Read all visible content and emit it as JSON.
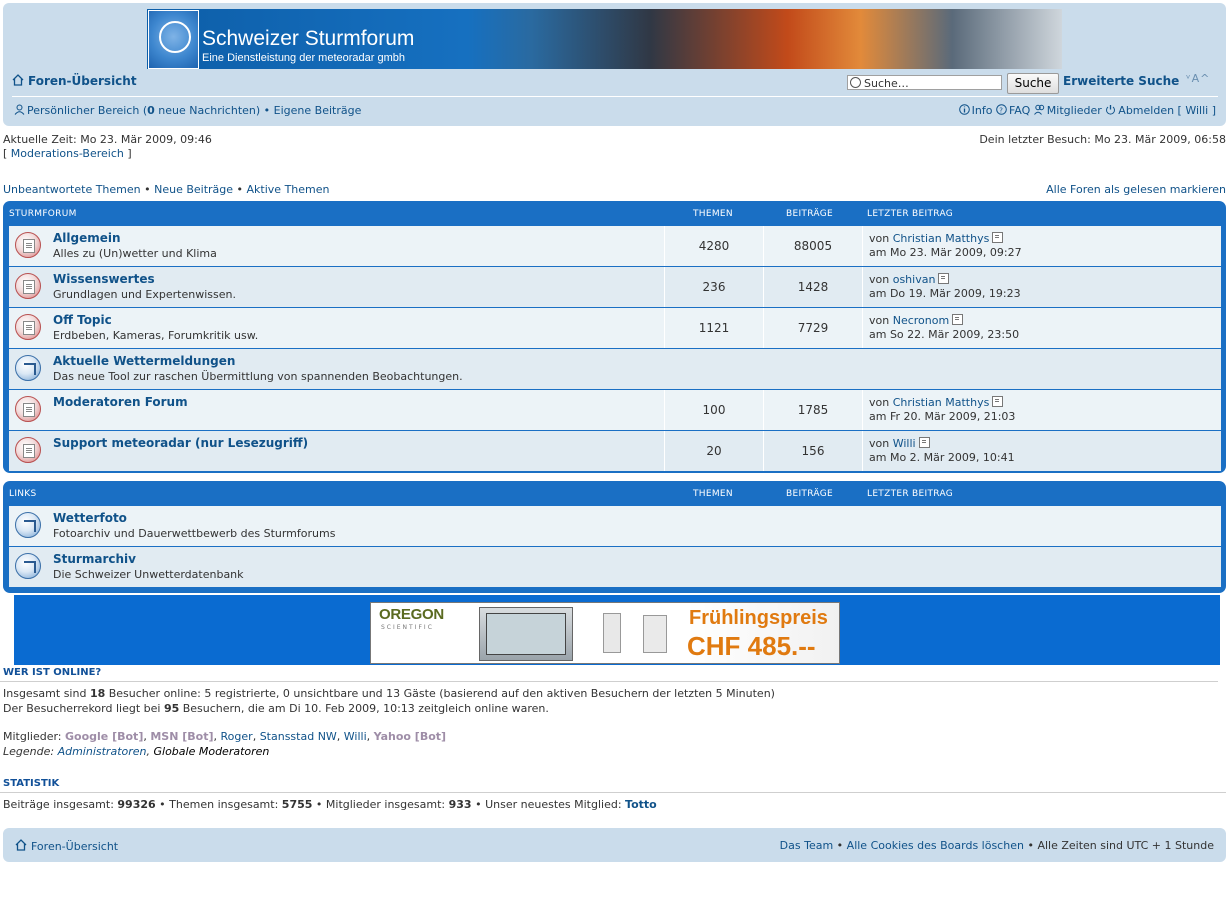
{
  "header": {
    "banner_title": "Schweizer Sturmforum",
    "banner_subtitle": "Eine Dienstleistung der meteoradar gmbh",
    "nav_home": "Foren-Übersicht",
    "search_value": "Suche…",
    "search_button": "Suche",
    "advanced_search": "Erweiterte Suche",
    "font_size_control": "ᵛA^",
    "user_area_a": "Persönlicher Bereich (",
    "user_area_count": "0",
    "user_area_b": " neue Nachrichten)",
    "sep": " • ",
    "own_posts": "Eigene Beiträge",
    "info": "Info",
    "faq": "FAQ",
    "members": "Mitglieder",
    "logout": "Abmelden [ Willi ]"
  },
  "status": {
    "current_time": "Aktuelle Zeit: Mo 23. Mär 2009, 09:46",
    "last_visit": "Dein letzter Besuch: Mo 23. Mär 2009, 06:58",
    "mod_open": "[ ",
    "mod_link": "Moderations-Bereich",
    "mod_close": " ]"
  },
  "quicklinks": {
    "unanswered": "Unbeantwortete Themen",
    "new_posts": "Neue Beiträge",
    "active": "Aktive Themen",
    "sep": " • ",
    "mark_read": "Alle Foren als gelesen markieren"
  },
  "columns": {
    "topics": "THEMEN",
    "posts": "BEITRÄGE",
    "last_post": "LETZTER BEITRAG"
  },
  "sturmforum": {
    "title": "STURMFORUM",
    "rows": [
      {
        "name": "Allgemein",
        "desc": "Alles zu (Un)wetter und Klima",
        "topics": "4280",
        "posts": "88005",
        "by": "von ",
        "user": "Christian Matthys",
        "date": "am Mo 23. Mär 2009, 09:27"
      },
      {
        "name": "Wissenswertes",
        "desc": "Grundlagen und Expertenwissen.",
        "topics": "236",
        "posts": "1428",
        "by": "von ",
        "user": "oshivan",
        "date": "am Do 19. Mär 2009, 19:23"
      },
      {
        "name": "Off Topic",
        "desc": "Erdbeben, Kameras, Forumkritik usw.",
        "topics": "1121",
        "posts": "7729",
        "by": "von ",
        "user": "Necronom",
        "date": "am So 22. Mär 2009, 23:50"
      },
      {
        "name": "Aktuelle Wettermeldungen",
        "desc": "Das neue Tool zur raschen Übermittlung von spannenden Beobachtungen."
      },
      {
        "name": "Moderatoren Forum",
        "desc": "",
        "topics": "100",
        "posts": "1785",
        "by": "von ",
        "user": "Christian Matthys",
        "date": "am Fr 20. Mär 2009, 21:03"
      },
      {
        "name": "Support meteoradar (nur Lesezugriff)",
        "desc": "",
        "topics": "20",
        "posts": "156",
        "by": "von ",
        "user": "Willi",
        "date": "am Mo 2. Mär 2009, 10:41"
      }
    ]
  },
  "links": {
    "title": "LINKS",
    "rows": [
      {
        "name": "Wetterfoto",
        "desc": "Fotoarchiv und Dauerwettbewerb des Sturmforums"
      },
      {
        "name": "Sturmarchiv",
        "desc": "Die Schweizer Unwetterdatenbank"
      }
    ]
  },
  "ad": {
    "brand": "OREGON",
    "brand_sub": "SCIENTIFIC",
    "headline": "Frühlingspreis",
    "price": "CHF 485.--"
  },
  "online": {
    "heading": "WER IST ONLINE?",
    "l1a": "Insgesamt sind ",
    "l1n": "18",
    "l1b": " Besucher online: 5 registrierte, 0 unsichtbare und 13 Gäste (basierend auf den aktiven Besuchern der letzten 5 Minuten)",
    "l2a": "Der Besucherrekord liegt bei ",
    "l2n": "95",
    "l2b": " Besuchern, die am Di 10. Feb 2009, 10:13 zeitgleich online waren.",
    "members_label": "Mitglieder: ",
    "m1": "Google [Bot]",
    "m2": "MSN [Bot]",
    "m3": "Roger",
    "m4": "Stansstad NW",
    "m5": "Willi",
    "m6": "Yahoo [Bot]",
    "comma": ", ",
    "legend_label": "Legende: ",
    "legend_admin": "Administratoren",
    "legend_mod": "Globale Moderatoren"
  },
  "stats": {
    "heading": "STATISTIK",
    "p_label": "Beiträge insgesamt: ",
    "p_val": "99326",
    "t_label": "Themen insgesamt: ",
    "t_val": "5755",
    "m_label": "Mitglieder insgesamt: ",
    "m_val": "933",
    "n_label": "Unser neuestes Mitglied: ",
    "n_val": "Totto"
  },
  "footer": {
    "home": "Foren-Übersicht",
    "team": "Das Team",
    "cookies": "Alle Cookies des Boards löschen",
    "timezone": "Alle Zeiten sind UTC + 1 Stunde"
  },
  "colors": {
    "header_bg": "#cadceb",
    "table_blue": "#1a6fc4",
    "link": "#105289",
    "bot": "#9e8da7",
    "ad_bar": "#0a6bd1"
  }
}
